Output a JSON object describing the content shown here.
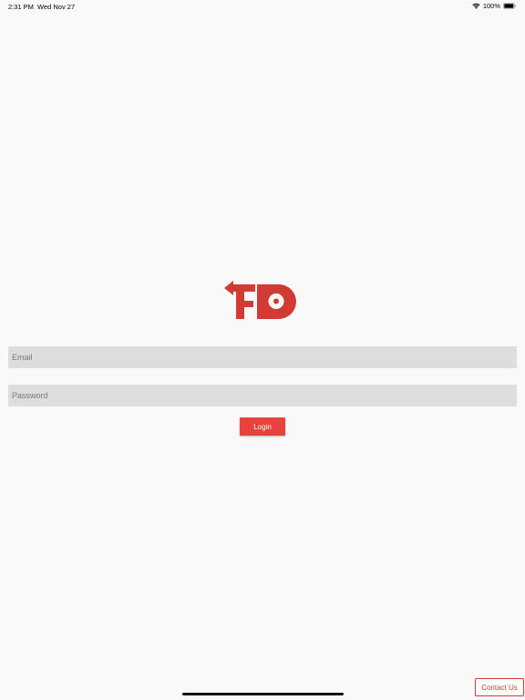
{
  "status_bar": {
    "time": "2:31 PM",
    "date": "Wed Nov 27",
    "battery": "100%",
    "icons": [
      "wifi-icon",
      "battery-icon"
    ]
  },
  "logo": {
    "icon": "fd-logo",
    "colors": [
      "#d23b33"
    ]
  },
  "login_form": {
    "email_placeholder": "Email",
    "email_value": "",
    "password_placeholder": "Password",
    "password_value": "",
    "login_label": "Login"
  },
  "footer": {
    "contact_label": "Contact Us"
  },
  "colors": {
    "accent": "#e9423d",
    "field_bg": "#dddddd",
    "background": "#f9f9f9"
  }
}
